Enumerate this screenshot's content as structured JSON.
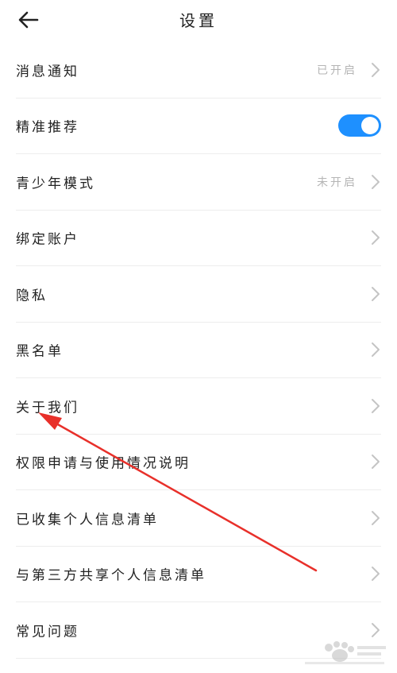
{
  "header": {
    "title": "设置",
    "back_icon": "arrow-left-icon"
  },
  "settings": {
    "items": [
      {
        "label": "消息通知",
        "status": "已开启",
        "control": "chevron"
      },
      {
        "label": "精准推荐",
        "control": "toggle",
        "toggle_on": true
      },
      {
        "label": "青少年模式",
        "status": "未开启",
        "control": "chevron"
      },
      {
        "label": "绑定账户",
        "control": "chevron"
      },
      {
        "label": "隐私",
        "control": "chevron"
      },
      {
        "label": "黑名单",
        "control": "chevron"
      },
      {
        "label": "关于我们",
        "control": "chevron"
      },
      {
        "label": "权限申请与使用情况说明",
        "control": "chevron"
      },
      {
        "label": "已收集个人信息清单",
        "control": "chevron"
      },
      {
        "label": "与第三方共享个人信息清单",
        "control": "chevron"
      },
      {
        "label": "常见问题",
        "control": "chevron"
      }
    ]
  },
  "colors": {
    "accent": "#1e90ff",
    "annotation_arrow": "#e8302a",
    "status_text": "#b5b5b5",
    "chevron": "#c4c4c4"
  }
}
